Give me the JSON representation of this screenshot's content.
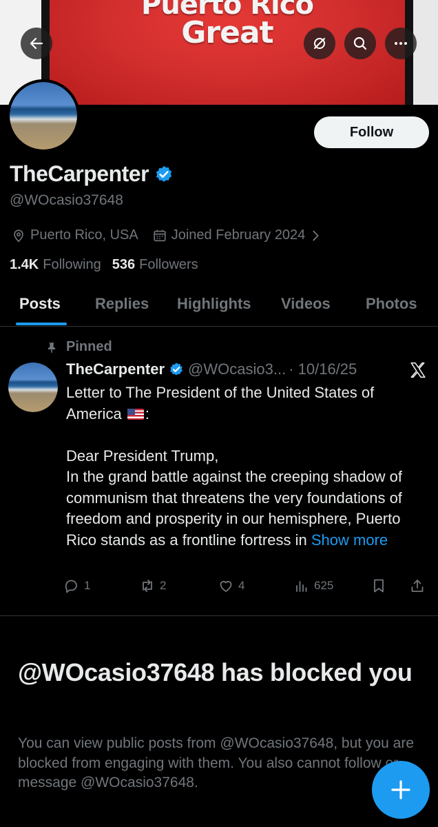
{
  "banner": {
    "text_line1": "Puerto Rico",
    "text_line2": "Great"
  },
  "header_icons": [
    "back-arrow-icon",
    "grok-icon",
    "search-icon",
    "more-icon"
  ],
  "profile": {
    "follow_label": "Follow",
    "display_name": "TheCarpenter",
    "handle": "@WOcasio37648",
    "location": "Puerto Rico, USA",
    "joined": "Joined February 2024",
    "following_count": "1.4K",
    "following_label": "Following",
    "followers_count": "536",
    "followers_label": "Followers"
  },
  "tabs": [
    "Posts",
    "Replies",
    "Highlights",
    "Videos",
    "Photos"
  ],
  "post": {
    "pinned_label": "Pinned",
    "author": "TheCarpenter",
    "handle": "@WOcasio3...",
    "date": "· 10/16/25",
    "text_line1": "Letter to The President of the United States of America",
    "text_after_flag": ":",
    "text_body": "Dear President Trump,\nIn the grand battle against the creeping shadow of communism that threatens the very foundations of freedom and prosperity in our hemisphere, Puerto Rico stands as a frontline fortress in",
    "show_more": "Show more",
    "replies": "1",
    "reposts": "2",
    "likes": "4",
    "views": "625"
  },
  "blocked": {
    "title": "@WOcasio37648 has blocked you",
    "description": "You can view public posts from @WOcasio37648, but you are blocked from engaging with them. You also cannot follow or message @WOcasio37648."
  },
  "colors": {
    "accent": "#1d9bf0",
    "muted": "#71767b",
    "text": "#e7e9ea",
    "background": "#000000"
  }
}
